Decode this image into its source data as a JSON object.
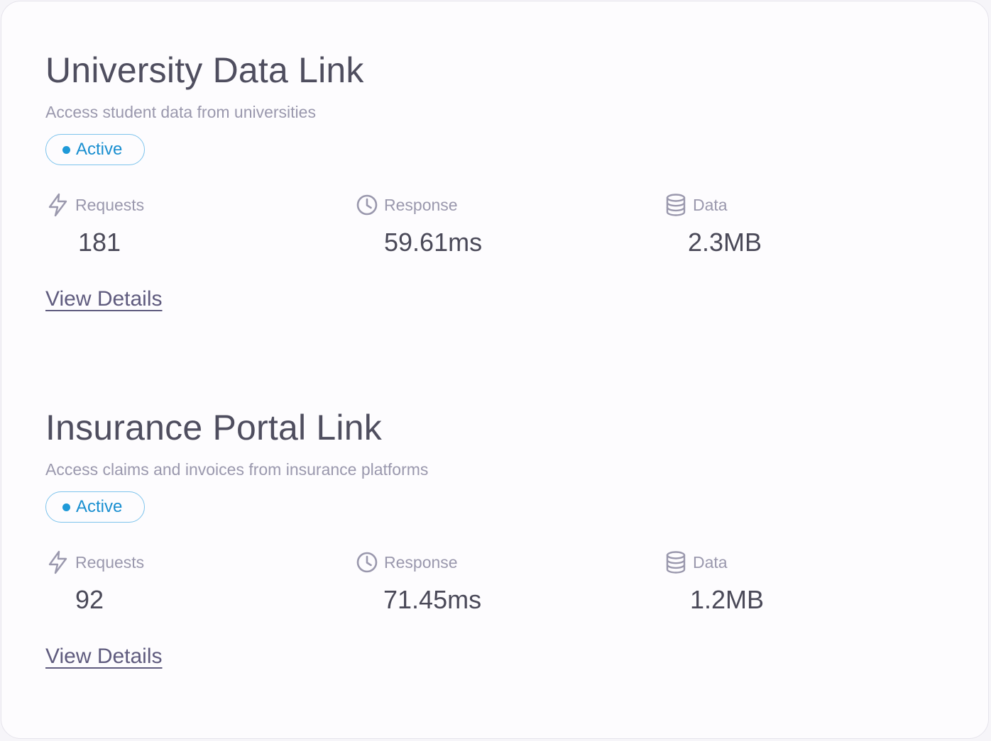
{
  "integrations": [
    {
      "title": "University Data Link",
      "description": "Access student data from universities",
      "status": "Active",
      "metrics": {
        "requests": {
          "label": "Requests",
          "value": "181",
          "icon": "lightning-icon"
        },
        "response": {
          "label": "Response",
          "value": "59.61ms",
          "icon": "clock-icon"
        },
        "data": {
          "label": "Data",
          "value": "2.3MB",
          "icon": "database-icon"
        }
      },
      "link_label": "View Details"
    },
    {
      "title": "Insurance Portal Link",
      "description": "Access claims and invoices from insurance platforms",
      "status": "Active",
      "metrics": {
        "requests": {
          "label": "Requests",
          "value": "92",
          "icon": "lightning-icon"
        },
        "response": {
          "label": "Response",
          "value": "71.45ms",
          "icon": "clock-icon"
        },
        "data": {
          "label": "Data",
          "value": "1.2MB",
          "icon": "database-icon"
        }
      },
      "link_label": "View Details"
    }
  ],
  "colors": {
    "status_active": "#1f9ad8",
    "status_border": "#7cc3ec",
    "icon": "#9a98ad",
    "title": "#4f4e5f",
    "link": "#5f5b7e"
  }
}
